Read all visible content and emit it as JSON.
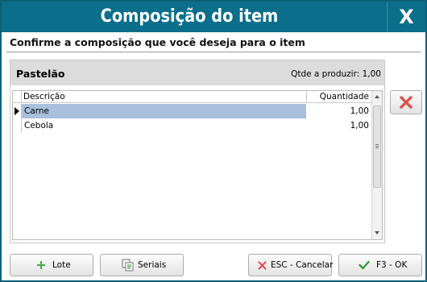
{
  "window": {
    "title": "Composição do item",
    "close_label": "X"
  },
  "subtitle": "Confirme a composição que você deseja para o item",
  "panel": {
    "item_name": "Pastelão",
    "qty_to_produce": "Qtde a produzir: 1,00"
  },
  "grid": {
    "columns": [
      "Descrição",
      "Quantidade"
    ],
    "rows": [
      {
        "descricao": "Carne",
        "quantidade": "1,00",
        "selected": true
      },
      {
        "descricao": "Cebola",
        "quantidade": "1,00",
        "selected": false
      }
    ]
  },
  "buttons": {
    "lote": "Lote",
    "seriais": "Seriais",
    "cancel": "ESC - Cancelar",
    "ok": "F3 - OK"
  },
  "colors": {
    "titlebar": "#0b6f8c",
    "selected_row": "#a8c0dc",
    "delete_red": "#d9534f",
    "ok_green": "#3a9a3a"
  },
  "icons": {
    "close": "close-icon",
    "delete": "delete-icon",
    "lote": "plus-icon",
    "seriais": "serial-copy-icon",
    "cancel": "cancel-x-icon",
    "ok": "checkmark-icon"
  }
}
